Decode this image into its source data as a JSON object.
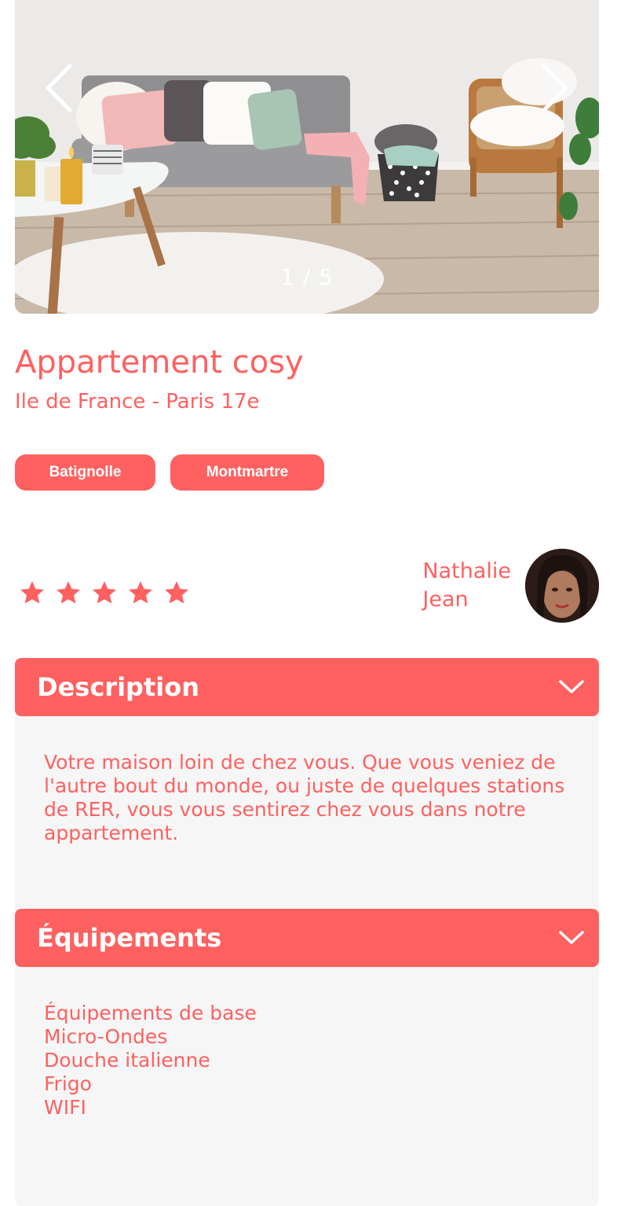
{
  "carousel": {
    "counter": "1 / 5",
    "prev_icon": "chevron-left-icon",
    "next_icon": "chevron-right-icon"
  },
  "listing": {
    "title": "Appartement cosy",
    "location": "Ile de France - Paris 17e",
    "tags": [
      "Batignolle",
      "Montmartre"
    ]
  },
  "rating": {
    "value": 5,
    "max": 5,
    "icon": "star-icon"
  },
  "host": {
    "first_name": "Nathalie",
    "last_name": "Jean"
  },
  "description": {
    "title": "Description",
    "text": "Votre maison loin de chez vous. Que vous veniez de l'autre bout du monde, ou juste de quelques stations de RER, vous vous sentirez chez vous dans notre appartement."
  },
  "equipments": {
    "title": "Équipements",
    "items": [
      "Équipements de base",
      "Micro-Ondes",
      "Douche italienne",
      "Frigo",
      "WIFI"
    ]
  },
  "colors": {
    "accent": "#FF6060",
    "panel_bg": "#F6F6F6",
    "white": "#FFFFFF"
  }
}
